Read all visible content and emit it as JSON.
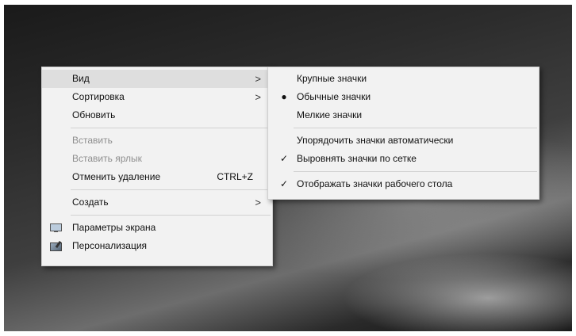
{
  "context_menu": {
    "view": "Вид",
    "sort": "Сортировка",
    "refresh": "Обновить",
    "paste": "Вставить",
    "paste_shortcut": "Вставить ярлык",
    "undo_delete": "Отменить удаление",
    "undo_delete_key": "CTRL+Z",
    "new": "Создать",
    "display_settings": "Параметры экрана",
    "personalize": "Персонализация",
    "arrow_glyph": ">"
  },
  "view_submenu": {
    "large_icons": "Крупные значки",
    "medium_icons": "Обычные значки",
    "small_icons": "Мелкие значки",
    "auto_arrange": "Упорядочить значки автоматически",
    "align_to_grid": "Выровнять значки по сетке",
    "show_desktop_icons": "Отображать значки рабочего стола",
    "bullet_glyph": "●",
    "check_glyph": "✓"
  }
}
